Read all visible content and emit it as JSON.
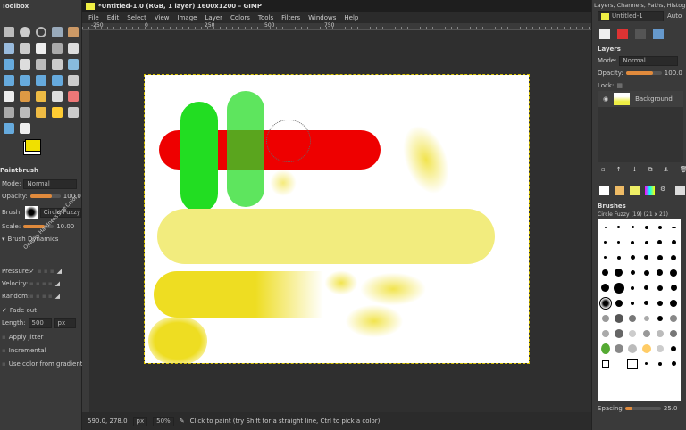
{
  "toolbox": {
    "title": "Toolbox",
    "tool_options_title": "Paintbrush",
    "mode_label": "Mode:",
    "mode_value": "Normal",
    "opacity_label": "Opacity:",
    "opacity_value": "100.0",
    "opacity_fraction": 1.0,
    "brush_label": "Brush:",
    "brush_value": "Circle Fuzzy (19)",
    "scale_label": "Scale:",
    "scale_value": "10.00",
    "dynamics_label": "Brush Dynamics",
    "dynamics_columns": [
      "Opacity",
      "Hardness",
      "Size",
      "Color"
    ],
    "dynamics_rows": [
      "Pressure:",
      "Velocity:",
      "Random:"
    ],
    "fade_out_label": "Fade out",
    "fade_out_checked": true,
    "length_label": "Length:",
    "length_value": "500",
    "length_unit": "px",
    "apply_jitter": "Apply Jitter",
    "incremental": "Incremental",
    "use_gradient": "Use color from gradient",
    "fg_color": "#f0e000",
    "bg_color": "#ffffff"
  },
  "image_window": {
    "title": "*Untitled-1.0 (RGB, 1 layer) 1600x1200 – GIMP",
    "menu": [
      "File",
      "Edit",
      "Select",
      "View",
      "Image",
      "Layer",
      "Colors",
      "Tools",
      "Filters",
      "Windows",
      "Help"
    ],
    "ruler_ticks": [
      "-250",
      "0",
      "250",
      "500",
      "750"
    ]
  },
  "status": {
    "coords": "590.0, 278.0",
    "unit": "px",
    "zoom": "50%",
    "message": "Click to paint (try Shift for a straight line, Ctrl to pick a color)"
  },
  "dock": {
    "title": "Layers, Channels, Paths, Histogram - B...",
    "image_select": "Untitled-1",
    "auto_label": "Auto",
    "layers_title": "Layers",
    "mode_label": "Mode:",
    "mode_value": "Normal",
    "opacity_label": "Opacity:",
    "opacity_value": "100.0",
    "lock_label": "Lock:",
    "layer_name": "Background",
    "brushes_title": "Brushes",
    "brush_name": "Circle Fuzzy (19) (21 x 21)",
    "spacing_label": "Spacing",
    "spacing_value": "25.0"
  }
}
